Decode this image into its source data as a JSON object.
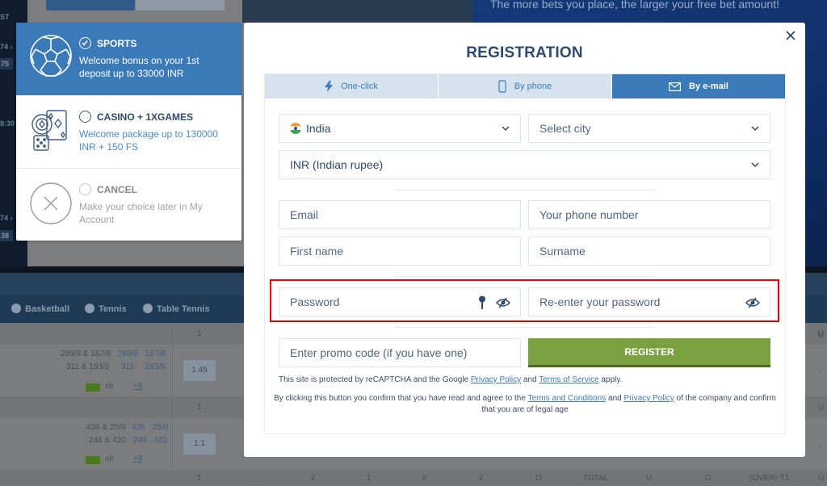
{
  "background": {
    "promo_banner": "The more bets you place, the larger your free bet amount!",
    "left_strip": [
      "ST",
      "74 ›",
      "75",
      "8:30",
      "74 ›",
      "38"
    ],
    "sports_nav": [
      "Basketball",
      "Tennis",
      "Table Tennis"
    ],
    "rows": [
      {
        "header_col1": "1",
        "header_right": "U"
      },
      {
        "score_line1_a": "289/9 & 187/8",
        "score_line1_b": "289/9",
        "score_line1_c": "187/8",
        "score_line2_a": "311 & 193/9",
        "score_line2_b": "311",
        "score_line2_c": "193/9",
        "odds": "1.45",
        "more": "+5"
      },
      {
        "header_col1": "1",
        "header_right": "U"
      },
      {
        "score_line1_a": "436 & 25/0",
        "score_line1_b": "436",
        "score_line1_c": "25/0",
        "score_line2_a": "246 & 420",
        "score_line2_b": "246",
        "score_line2_c": "420",
        "odds": "1.1",
        "more": "+8"
      }
    ],
    "footer_headers": [
      "1",
      "-",
      "2",
      "1",
      "X",
      "2",
      "O",
      "TOTAL",
      "U",
      "O",
      "(OVER) T1",
      "U"
    ],
    "right_col": [
      "U",
      "-",
      "U",
      "-"
    ]
  },
  "bonus_panel": {
    "options": [
      {
        "title": "SPORTS",
        "desc": "Welcome bonus on your 1st deposit up to 33000 INR",
        "selected": true,
        "icon": "soccer-ball-icon"
      },
      {
        "title": "CASINO + 1XGAMES",
        "desc": "Welcome package up to 130000 INR + 150 FS",
        "selected": false,
        "icon": "casino-chips-cards-icon"
      },
      {
        "title": "CANCEL",
        "desc": "Make your choice later in My Account",
        "selected": false,
        "icon": "cancel-circle-icon"
      }
    ]
  },
  "modal": {
    "title": "REGISTRATION",
    "close_icon": "close-icon",
    "tabs": [
      {
        "label": "One-click",
        "icon": "lightning-icon",
        "active": false
      },
      {
        "label": "By phone",
        "icon": "phone-icon",
        "active": false
      },
      {
        "label": "By e-mail",
        "icon": "envelope-icon",
        "active": true
      }
    ],
    "form": {
      "country": {
        "value": "India",
        "icon": "india-flag-icon"
      },
      "city": {
        "placeholder": "Select city"
      },
      "currency": {
        "value": "INR (Indian rupee)"
      },
      "email": {
        "placeholder": "Email"
      },
      "phone": {
        "placeholder": "Your phone number"
      },
      "first_name": {
        "placeholder": "First name"
      },
      "surname": {
        "placeholder": "Surname"
      },
      "password": {
        "placeholder": "Password"
      },
      "password_confirm": {
        "placeholder": "Re-enter your password"
      },
      "promo": {
        "placeholder": "Enter promo code (if you have one)"
      },
      "register_label": "REGISTER"
    },
    "recaptcha_note": {
      "prefix": "This site is protected by reCAPTCHA and the Google ",
      "privacy_link": "Privacy Policy",
      "middle": " and ",
      "terms_link": "Terms of Service",
      "suffix": " apply."
    },
    "consent_note": {
      "prefix": "By clicking this button you confirm that you have read and agree to the ",
      "terms_link": "Terms and Conditions",
      "middle": " and ",
      "privacy_link": "Privacy Policy",
      "suffix": " of the company and confirm that you are of legal age"
    }
  },
  "colors": {
    "accent_blue": "#3a7ab9",
    "register_green": "#7aa03f",
    "highlight_red": "#e60000",
    "heading_navy": "#2c4a6d"
  }
}
